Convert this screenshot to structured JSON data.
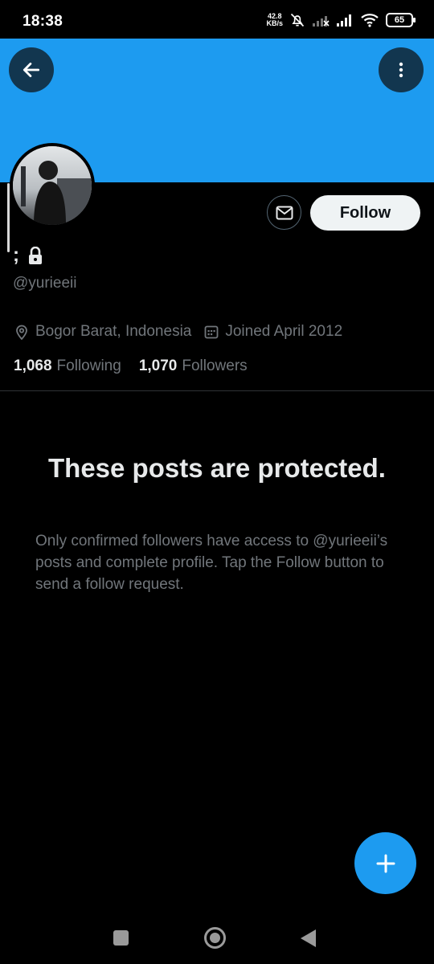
{
  "status_bar": {
    "time": "18:38",
    "net_speed_value": "42.8",
    "net_speed_unit": "KB/s",
    "battery": "65",
    "icons": [
      "mute-bell-icon",
      "signal-off-icon",
      "signal-icon",
      "wifi-icon",
      "battery-icon"
    ]
  },
  "header": {
    "banner_color": "#1d9bf0",
    "back_icon": "arrow-left-icon",
    "more_icon": "more-vertical-icon"
  },
  "profile": {
    "display_name": ";",
    "protected_icon": "lock-icon",
    "handle": "@yurieeii",
    "location": "Bogor Barat, Indonesia",
    "joined": "Joined April 2012",
    "following_count": "1,068",
    "following_label": "Following",
    "followers_count": "1,070",
    "followers_label": "Followers"
  },
  "actions": {
    "message_icon": "envelope-icon",
    "follow_label": "Follow"
  },
  "protected": {
    "title": "These posts are protected.",
    "body": "Only confirmed followers have access to @yurieeii’s posts and complete profile. Tap the Follow button to send a follow request."
  },
  "fab": {
    "icon": "plus-icon"
  },
  "nav": {
    "icons": [
      "recents-square-icon",
      "home-circle-icon",
      "back-triangle-icon"
    ]
  }
}
